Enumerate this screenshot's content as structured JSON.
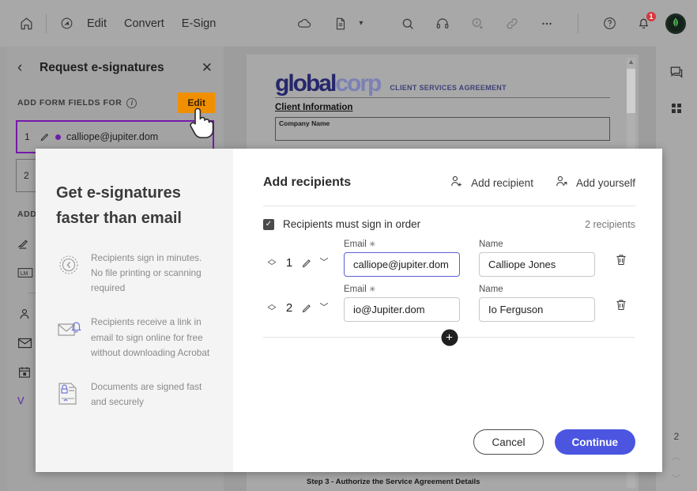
{
  "toolbar": {
    "home_icon": "home-icon",
    "tools_icon": "tools-icon",
    "menus": [
      "Edit",
      "Convert",
      "E-Sign"
    ],
    "cloud_icon": "cloud-icon",
    "document_icon": "document-icon",
    "doc_chevron": "chevron-down-icon",
    "search_icon": "search-icon",
    "headphones_icon": "headphones-icon",
    "record_icon": "record-voice-icon",
    "link_icon": "link-icon",
    "more_icon": "more-options-icon",
    "help_icon": "help-icon",
    "bell_icon": "notifications-icon",
    "bell_badge": "1",
    "avatar": "user-avatar"
  },
  "left_panel": {
    "back_icon": "chevron-left-icon",
    "title": "Request e-signatures",
    "close_icon": "close-icon",
    "section_label": "ADD FORM FIELDS FOR",
    "info_icon": "info-icon",
    "edit_label": "Edit",
    "recipients": [
      {
        "num": "1",
        "email": "calliope@jupiter.dom",
        "pen_icon": "signature-pen-icon"
      },
      {
        "num": "2",
        "email": "",
        "pen_icon": "signature-pen-icon"
      }
    ],
    "fields_section_label": "ADD",
    "field_icons": [
      "signature-field-icon",
      "initials-field-icon",
      "name-field-icon",
      "email-field-icon",
      "date-field-icon"
    ],
    "footer_link": "V"
  },
  "document": {
    "logo_first": "global",
    "logo_second": "corp",
    "agreement_title": "CLIENT SERVICES AGREEMENT",
    "section_heading": "Client Information",
    "field_box_label": "Company Name",
    "footer_step": "Step 3 - Authorize the Service Agreement Details"
  },
  "right_rail": {
    "comment_icon": "comment-icon",
    "thumbnails_icon": "page-thumbnails-icon",
    "page_number": "2",
    "prev_icon": "chevron-up-icon",
    "next_icon": "chevron-down-icon"
  },
  "modal": {
    "promo": {
      "title_line1": "Get e-signatures",
      "title_line2": "faster than email",
      "features": [
        {
          "icon": "clock-icon",
          "text": "Recipients sign in minutes. No file printing or scanning required"
        },
        {
          "icon": "email-notification-icon",
          "text": "Recipients receive a link in email to sign online for free without downloading Acrobat"
        },
        {
          "icon": "secure-document-icon",
          "text": "Documents are signed fast and securely"
        }
      ]
    },
    "heading": "Add recipients",
    "add_recipient_label": "Add recipient",
    "add_recipient_icon": "add-recipient-icon",
    "add_yourself_label": "Add yourself",
    "add_yourself_icon": "add-yourself-icon",
    "sign_in_order_label": "Recipients must sign in order",
    "sign_in_order_checked": true,
    "recipient_count": "2 recipients",
    "email_label": "Email",
    "name_label": "Name",
    "required_mark": "✳",
    "rows": [
      {
        "num": "1",
        "role_icon": "signature-pen-icon",
        "role_chevron": "chevron-down-icon",
        "email": "calliope@jupiter.dom",
        "name": "Calliope Jones",
        "trash_icon": "delete-icon",
        "focused": true
      },
      {
        "num": "2",
        "role_icon": "signature-pen-icon",
        "role_chevron": "chevron-down-icon",
        "email": "io@Jupiter.dom",
        "name": "Io Ferguson",
        "trash_icon": "delete-icon",
        "focused": false
      }
    ],
    "add_row_icon": "add-row-icon",
    "cancel_label": "Cancel",
    "continue_label": "Continue"
  },
  "colors": {
    "accent_purple": "#7719aa",
    "continue_blue": "#4b55e0",
    "highlight_orange": "#f09000",
    "badge_red": "#d7373f"
  }
}
